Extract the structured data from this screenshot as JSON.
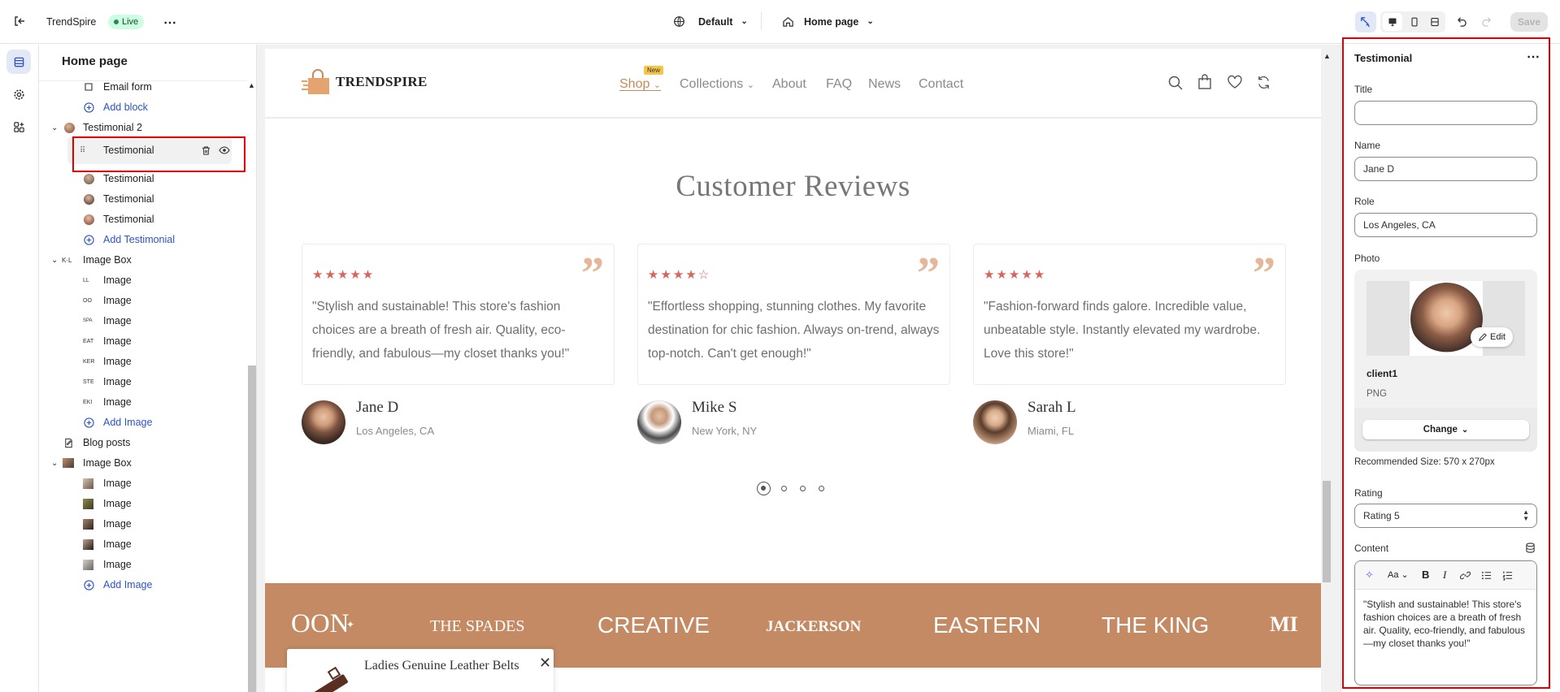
{
  "topbar": {
    "store_name": "TrendSpire",
    "live_badge": "Live",
    "theme_selector": "Default",
    "page_selector": "Home page",
    "save_label": "Save"
  },
  "tree": {
    "title": "Home page",
    "rows": [
      {
        "label": "Email form",
        "type": "block"
      },
      {
        "label": "Add block",
        "type": "add"
      },
      {
        "label": "Testimonial 2",
        "type": "section"
      },
      {
        "label": "Testimonial",
        "type": "selected"
      },
      {
        "label": "Testimonial",
        "type": "block"
      },
      {
        "label": "Testimonial",
        "type": "block"
      },
      {
        "label": "Testimonial",
        "type": "block"
      },
      {
        "label": "Add Testimonial",
        "type": "add"
      },
      {
        "label": "Image Box",
        "type": "section"
      },
      {
        "label": "Image",
        "type": "block",
        "thumb_text": "LL"
      },
      {
        "label": "Image",
        "type": "block",
        "thumb_text": "OO"
      },
      {
        "label": "Image",
        "type": "block",
        "thumb_text": "SPA"
      },
      {
        "label": "Image",
        "type": "block",
        "thumb_text": "EAT"
      },
      {
        "label": "Image",
        "type": "block",
        "thumb_text": "KER"
      },
      {
        "label": "Image",
        "type": "block",
        "thumb_text": "STE"
      },
      {
        "label": "Image",
        "type": "block",
        "thumb_text": "EKI"
      },
      {
        "label": "Add Image",
        "type": "add"
      },
      {
        "label": "Blog posts",
        "type": "section-plain"
      },
      {
        "label": "Image Box",
        "type": "section"
      },
      {
        "label": "Image",
        "type": "block"
      },
      {
        "label": "Image",
        "type": "block"
      },
      {
        "label": "Image",
        "type": "block"
      },
      {
        "label": "Image",
        "type": "block"
      },
      {
        "label": "Image",
        "type": "block"
      },
      {
        "label": "Add Image",
        "type": "add"
      }
    ]
  },
  "site": {
    "logo": "TRENDSPIRE",
    "nav": [
      {
        "label": "Shop",
        "badge": "New",
        "dropdown": true,
        "active": true
      },
      {
        "label": "Collections",
        "dropdown": true
      },
      {
        "label": "About"
      },
      {
        "label": "FAQ"
      },
      {
        "label": "News"
      },
      {
        "label": "Contact"
      }
    ],
    "section_title": "Customer Reviews",
    "reviews": [
      {
        "rating": 5,
        "text": "\"Stylish and sustainable! This store's fashion choices are a breath of fresh air. Quality, eco-friendly, and fabulous—my closet thanks you!\"",
        "name": "Jane D",
        "location": "Los Angeles, CA"
      },
      {
        "rating": 4,
        "text": "\"Effortless shopping, stunning clothes. My favorite destination for chic fashion. Always on-trend, always top-notch. Can't get enough!\"",
        "name": "Mike S",
        "location": "New York, NY"
      },
      {
        "rating": 5,
        "text": "\"Fashion-forward finds galore. Incredible value, unbeatable style. Instantly elevated my wardrobe. Love this store!\"",
        "name": "Sarah L",
        "location": "Miami, FL"
      }
    ],
    "pagination": {
      "total": 4,
      "current": 1
    },
    "brands": [
      "OON",
      "THE SPADES",
      "CREATIVE",
      "JACKERSON",
      "EASTERN",
      "THE KING",
      "MI"
    ],
    "popup": {
      "product": "Ladies Genuine Leather Belts"
    }
  },
  "settings": {
    "title": "Testimonial",
    "title_label": "Title",
    "title_value": "",
    "name_label": "Name",
    "name_value": "Jane D",
    "role_label": "Role",
    "role_value": "Los Angeles, CA",
    "photo_label": "Photo",
    "edit_label": "Edit",
    "file_name": "client1",
    "file_type": "PNG",
    "change_label": "Change",
    "recommended": "Recommended Size: 570 x 270px",
    "rating_label": "Rating",
    "rating_value": "Rating 5",
    "content_label": "Content",
    "content_value": "\"Stylish and sustainable! This store's fashion choices are a breath of fresh air. Quality, eco-friendly, and fabulous—my closet thanks you!\""
  },
  "colors": {
    "accent": "#c98a5c",
    "highlight": "#e00000",
    "link": "#2c54c9",
    "brand_band": "#c48a63",
    "star": "#d8645a"
  }
}
